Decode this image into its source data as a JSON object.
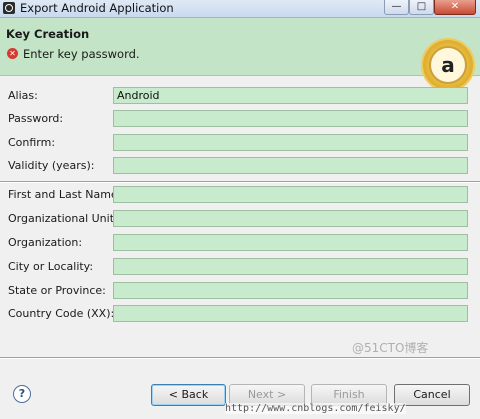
{
  "window": {
    "title": "Export Android Application",
    "min_label": "—",
    "max_label": "□",
    "close_label": "✕"
  },
  "header": {
    "page_title": "Key Creation",
    "error_message": "Enter key password.",
    "seal_text": "a"
  },
  "form": {
    "fields": [
      {
        "label": "Alias:",
        "value": "Android"
      },
      {
        "label": "Password:",
        "value": ""
      },
      {
        "label": "Confirm:",
        "value": ""
      },
      {
        "label": "Validity (years):",
        "value": ""
      },
      {
        "label": "First and Last Name:",
        "value": ""
      },
      {
        "label": "Organizational Unit:",
        "value": ""
      },
      {
        "label": "Organization:",
        "value": ""
      },
      {
        "label": "City or Locality:",
        "value": ""
      },
      {
        "label": "State or Province:",
        "value": ""
      },
      {
        "label": "Country Code (XX):",
        "value": ""
      }
    ]
  },
  "buttons": {
    "help": "?",
    "back": "< Back",
    "next": "Next >",
    "finish": "Finish",
    "cancel": "Cancel"
  },
  "watermark": {
    "url": "http://www.cnblogs.com/feisky/",
    "tag": "@51CTO博客"
  },
  "colors": {
    "header_bg": "#c3e4c6",
    "input_bg": "#c7ebcc",
    "error_red": "#d23b2f",
    "dialog_bg": "#f0f0f0"
  }
}
